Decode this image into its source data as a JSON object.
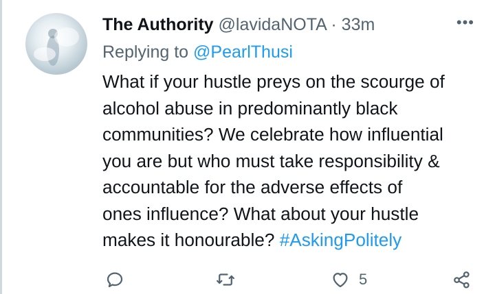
{
  "tweet": {
    "display_name": "The Authority",
    "handle": "@lavidaNOTA",
    "separator": "·",
    "time": "33m",
    "more_label": "•••",
    "replying_prefix": "Replying to",
    "replying_to": "@PearlThusi",
    "body_lines": [
      "What if your hustle preys on the scourge of",
      "alcohol abuse in predominantly black",
      "communities? We celebrate how influential",
      "you are but who must take responsibility &",
      "accountable for the adverse effects of",
      "ones influence? What about your hustle",
      "makes it honourable?"
    ],
    "hashtag": "#AskingPolitely"
  },
  "actions": {
    "reply_icon": "reply-icon",
    "retweet_icon": "retweet-icon",
    "like_icon": "heart-icon",
    "like_count": "5",
    "share_icon": "share-icon"
  },
  "colors": {
    "accent": "#1d9bf0",
    "muted": "#536471",
    "text": "#0f1419"
  }
}
